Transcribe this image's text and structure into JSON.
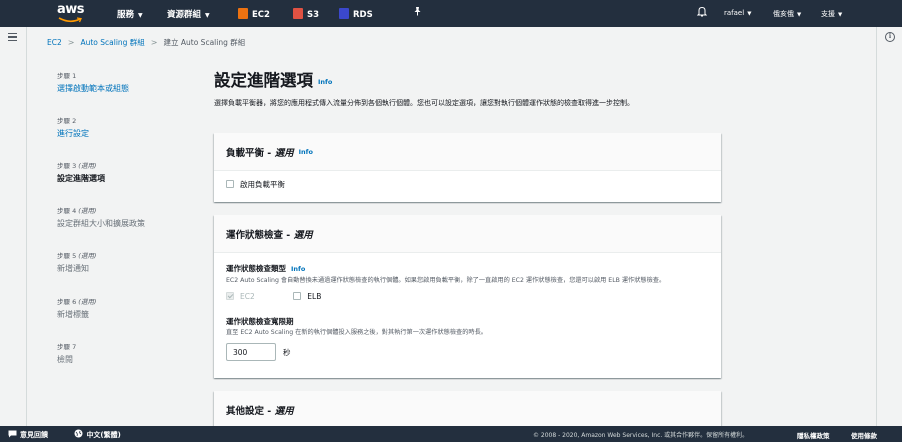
{
  "nav": {
    "logo": "aws",
    "services": "服務",
    "resource_groups": "資源群組",
    "ec2": "EC2",
    "s3": "S3",
    "rds": "RDS",
    "user": "rafael",
    "region": "俄亥俄",
    "support": "支援"
  },
  "breadcrumb": {
    "items": [
      "EC2",
      "Auto Scaling 群組"
    ],
    "current": "建立 Auto Scaling 群組"
  },
  "steps": [
    {
      "num": "步驟 1",
      "label": "選擇啟動範本或組態"
    },
    {
      "num": "步驟 2",
      "label": "進行設定"
    },
    {
      "num": "步驟 3",
      "optional": "(選用)",
      "label": "設定進階選項"
    },
    {
      "num": "步驟 4",
      "optional": "(選用)",
      "label": "設定群組大小和擴展政策"
    },
    {
      "num": "步驟 5",
      "optional": "(選用)",
      "label": "新增通知"
    },
    {
      "num": "步驟 6",
      "optional": "(選用)",
      "label": "新增標籤"
    },
    {
      "num": "步驟 7",
      "label": "檢閱"
    }
  ],
  "main": {
    "title": "設定進階選項",
    "info": "Info",
    "description": "選擇負載平衡器，將您的應用程式傳入流量分佈到各個執行個體。您也可以設定選項，讓您對執行個體運作狀態的檢查取得進一步控制。"
  },
  "lb_card": {
    "title": "負載平衡 - ",
    "title_opt": "選用",
    "info": "Info",
    "checkbox": "啟用負載平衡"
  },
  "health_card": {
    "title": "運作狀態檢查 - ",
    "title_opt": "選用",
    "type_label": "運作狀態檢查類型",
    "info": "Info",
    "type_desc": "EC2 Auto Scaling 會自動替換未通過運作狀態檢查的執行個體。如果您啟用負載平衡，除了一直啟用的 EC2 運作狀態檢查，您還可以啟用 ELB 運作狀態檢查。",
    "ec2": "EC2",
    "elb": "ELB",
    "grace_label": "運作狀態檢查寬限期",
    "grace_desc": "直至 EC2 Auto Scaling 在新的執行個體投入服務之後，對其執行第一次運作狀態檢查的時長。",
    "grace_value": "300",
    "grace_unit": "秒"
  },
  "other_card": {
    "title": "其他設定 - ",
    "title_opt": "選用"
  },
  "footer": {
    "feedback": "意見回饋",
    "language": "中文(繁體)",
    "copyright": "© 2008 - 2020, Amazon Web Services, Inc. 或其合作夥伴。保留所有權利。",
    "privacy": "隱私權政策",
    "terms": "使用條款"
  },
  "colors": {
    "nav_bg": "#232f3e",
    "link": "#0073bb",
    "ec2_icon": "#ec7211",
    "s3_icon": "#e05243",
    "rds_icon": "#3b48cc"
  }
}
